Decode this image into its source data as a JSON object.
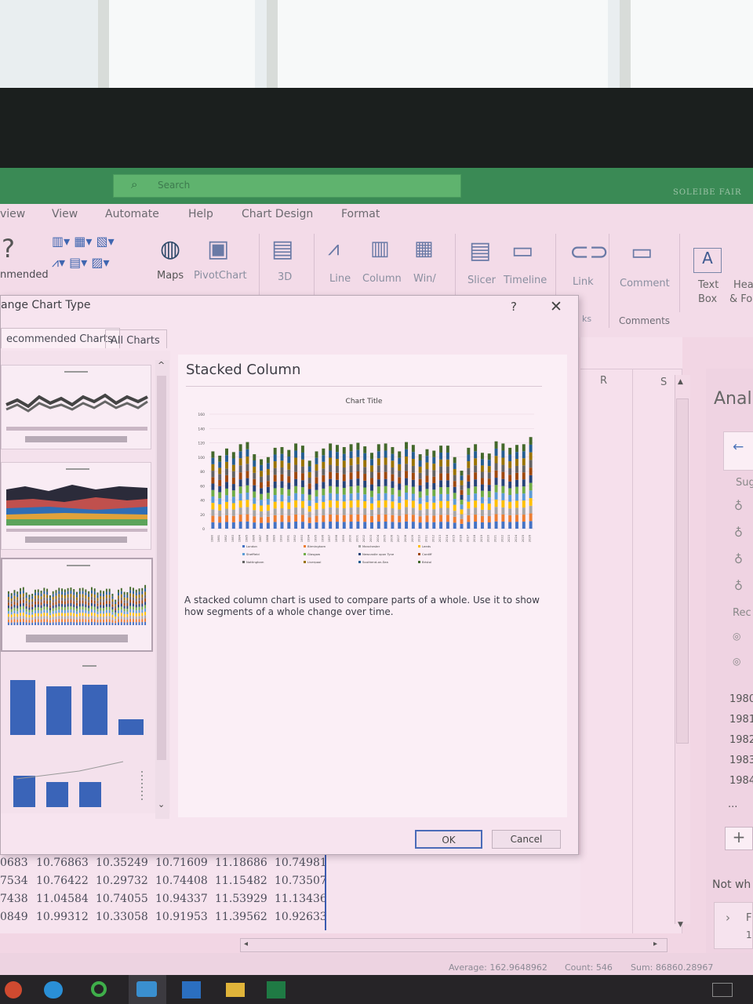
{
  "ribbon_tabs": [
    "view",
    "View",
    "Automate",
    "Help",
    "Chart Design",
    "Format"
  ],
  "search": {
    "placeholder": "Search"
  },
  "user": {
    "name": "SOLEIBE FAIR"
  },
  "ribbon": {
    "recommended": "nmended",
    "maps": "Maps",
    "pivotchart": "PivotChart",
    "three_d": "3D",
    "line": "Line",
    "column": "Column",
    "winloss": "Win/",
    "slicer": "Slicer",
    "timeline": "Timeline",
    "link": "Link",
    "comment": "Comment",
    "textbox_1": "Text",
    "textbox_2": "Box",
    "header_1": "Hea",
    "header_2": "& Fo",
    "group_links": "ks",
    "group_comments": "Comments"
  },
  "dialog": {
    "title": "ange Chart Type",
    "help": "?",
    "close": "✕",
    "tab_recommended": "ecommended Charts",
    "tab_all": "All Charts",
    "preview_title": "Stacked Column",
    "description": "A stacked column chart is used to compare parts of a whole. Use it to show how segments of a whole change over time.",
    "ok_label": "OK",
    "cancel_label": "Cancel"
  },
  "chart_data": {
    "type": "bar",
    "stacked": true,
    "title": "Chart Title",
    "ylim": [
      0,
      160
    ],
    "yticks": [
      0,
      20,
      40,
      60,
      80,
      100,
      120,
      140,
      160
    ],
    "categories": [
      "1980",
      "1981",
      "1982",
      "1983",
      "1984",
      "1985",
      "1986",
      "1987",
      "1988",
      "1989",
      "1990",
      "1991",
      "1992",
      "1993",
      "1994",
      "1995",
      "1996",
      "1997",
      "1998",
      "1999",
      "2000",
      "2001",
      "2002",
      "2003",
      "2004",
      "2005",
      "2006",
      "2007",
      "2008",
      "2009",
      "2010",
      "2011",
      "2012",
      "2013",
      "2014",
      "2015",
      "2016",
      "2017",
      "2018",
      "2019",
      "2020",
      "2021",
      "2022",
      "2023",
      "2024",
      "2025",
      "2026"
    ],
    "totals": [
      108,
      102,
      112,
      107,
      118,
      121,
      104,
      97,
      100,
      113,
      114,
      110,
      119,
      116,
      95,
      108,
      112,
      119,
      117,
      114,
      118,
      120,
      115,
      106,
      118,
      119,
      114,
      108,
      121,
      117,
      104,
      111,
      109,
      116,
      116,
      100,
      81,
      113,
      118,
      106,
      105,
      122,
      119,
      113,
      117,
      118,
      128
    ],
    "series": [
      {
        "name": "London",
        "color": "#4472c4"
      },
      {
        "name": "Birmingham",
        "color": "#ed7d31"
      },
      {
        "name": "Manchester",
        "color": "#a5a5a5"
      },
      {
        "name": "Leeds",
        "color": "#ffc000"
      },
      {
        "name": "Sheffield",
        "color": "#5b9bd5"
      },
      {
        "name": "Glasgow",
        "color": "#70ad47"
      },
      {
        "name": "Newcastle upon Tyne",
        "color": "#264478"
      },
      {
        "name": "Cardiff",
        "color": "#9e480e"
      },
      {
        "name": "Nottingham",
        "color": "#636363"
      },
      {
        "name": "Liverpool",
        "color": "#997300"
      },
      {
        "name": "Southend-on-Sea",
        "color": "#255e91"
      },
      {
        "name": "Bristol",
        "color": "#43682b"
      }
    ]
  },
  "sheet": {
    "col_r": "R",
    "col_s": "S",
    "rows": [
      [
        "0683",
        "10.76863",
        "10.35249",
        "10.71609",
        "11.18686",
        "10.74981"
      ],
      [
        "7534",
        "10.76422",
        "10.29732",
        "10.74408",
        "11.15482",
        "10.73507"
      ],
      [
        "7438",
        "11.04584",
        "10.74055",
        "10.94337",
        "11.53929",
        "11.13436"
      ],
      [
        "0849",
        "10.99312",
        "10.33058",
        "10.91953",
        "11.39562",
        "10.92633"
      ]
    ]
  },
  "analyze_pane": {
    "title": "Anal",
    "back": "←",
    "sug": "Sug",
    "rec": "Rec",
    "years": [
      "1980",
      "1981",
      "1982",
      "1983",
      "1984"
    ],
    "more": "...",
    "add": "+",
    "not_what": "Not wh",
    "next": "›",
    "next_label": "F",
    "next_sub": "1"
  },
  "status": {
    "average": "Average: 162.9648962",
    "count": "Count: 546",
    "sum": "Sum: 86860.28967"
  }
}
